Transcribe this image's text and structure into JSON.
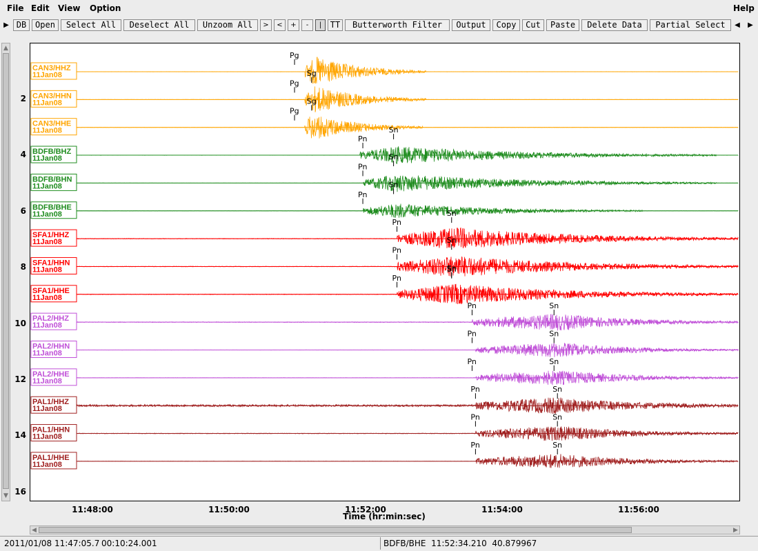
{
  "menus": {
    "file": "File",
    "edit": "Edit",
    "view": "View",
    "option": "Option",
    "help": "Help"
  },
  "toolbar": {
    "db": "DB",
    "open": "Open",
    "select_all": "Select All",
    "deselect_all": "Deselect All",
    "unzoom_all": "Unzoom All",
    "next": ">",
    "prev": "<",
    "plus": "+",
    "minus": "-",
    "cursor": "|",
    "tt": "TT",
    "butterworth": "Butterworth Filter",
    "output": "Output",
    "copy": "Copy",
    "cut": "Cut",
    "paste": "Paste",
    "delete_data": "Delete Data",
    "partial_select": "Partial Select"
  },
  "row_numbers": [
    "2",
    "4",
    "6",
    "8",
    "10",
    "12",
    "14",
    "16"
  ],
  "time_axis": {
    "ticks": [
      "11:48:00",
      "11:50:00",
      "11:52:00",
      "11:54:00",
      "11:56:00"
    ],
    "title": "Time (hr:min:sec)"
  },
  "colors": {
    "CAN3": "#ffa500",
    "BDFB": "#1e8c1e",
    "SFA1": "#ff0000",
    "PAL2": "#c050d8",
    "PAL1": "#a02020"
  },
  "traces": [
    {
      "station": "CAN3/HHZ",
      "date": "11Jan08",
      "color": "#ffa500",
      "onset": 4.1,
      "peak": 4.25,
      "amp": 2.2,
      "noise": 0.05,
      "dur": 0.9,
      "picks": [
        {
          "phase": "Pg",
          "t": 3.95,
          "yoff": -22
        },
        {
          "phase": "Sg",
          "t": 4.2,
          "yoff": 4
        }
      ]
    },
    {
      "station": "CAN3/HHN",
      "date": "11Jan08",
      "color": "#ffa500",
      "onset": 4.1,
      "peak": 4.25,
      "amp": 2.0,
      "noise": 0.05,
      "dur": 0.9,
      "picks": [
        {
          "phase": "Pg",
          "t": 3.95,
          "yoff": -22
        },
        {
          "phase": "Sg",
          "t": 4.2,
          "yoff": 4
        }
      ]
    },
    {
      "station": "CAN3/HHE",
      "date": "11Jan08",
      "color": "#ffa500",
      "onset": 4.1,
      "peak": 4.2,
      "amp": 1.9,
      "noise": 0.05,
      "dur": 0.9,
      "picks": [
        {
          "phase": "Pg",
          "t": 3.95,
          "yoff": -22
        }
      ]
    },
    {
      "station": "BDFB/BHZ",
      "date": "11Jan08",
      "color": "#1e8c1e",
      "onset": 4.9,
      "peak": 5.45,
      "amp": 1.3,
      "noise": 0.03,
      "dur": 2.6,
      "picks": [
        {
          "phase": "Pn",
          "t": 4.95,
          "yoff": -22
        },
        {
          "phase": "Sn",
          "t": 5.4,
          "yoff": -35
        },
        {
          "phase": "Sn",
          "t": 5.4,
          "yoff": 4
        }
      ]
    },
    {
      "station": "BDFB/BHN",
      "date": "11Jan08",
      "color": "#1e8c1e",
      "onset": 4.95,
      "peak": 5.45,
      "amp": 1.3,
      "noise": 0.03,
      "dur": 2.6,
      "picks": [
        {
          "phase": "Pn",
          "t": 4.95,
          "yoff": -22
        },
        {
          "phase": "Sn",
          "t": 5.4,
          "yoff": 4
        }
      ]
    },
    {
      "station": "BDFB/BHE",
      "date": "11Jan08",
      "color": "#1e8c1e",
      "onset": 4.95,
      "peak": 5.45,
      "amp": 1.1,
      "noise": 0.03,
      "dur": 2.0,
      "picks": [
        {
          "phase": "Pn",
          "t": 4.95,
          "yoff": -22
        }
      ]
    },
    {
      "station": "SFA1/HHZ",
      "date": "11Jan08",
      "color": "#ff0000",
      "onset": 5.45,
      "peak": 6.3,
      "amp": 1.6,
      "noise": 0.1,
      "dur": 3.0,
      "picks": [
        {
          "phase": "Pn",
          "t": 5.45,
          "yoff": -22
        },
        {
          "phase": "Sn",
          "t": 6.25,
          "yoff": -35
        },
        {
          "phase": "Sn",
          "t": 6.25,
          "yoff": 4
        }
      ]
    },
    {
      "station": "SFA1/HHN",
      "date": "11Jan08",
      "color": "#ff0000",
      "onset": 5.45,
      "peak": 6.3,
      "amp": 1.6,
      "noise": 0.1,
      "dur": 3.0,
      "picks": [
        {
          "phase": "Pn",
          "t": 5.45,
          "yoff": -22
        },
        {
          "phase": "Sn",
          "t": 6.25,
          "yoff": 4
        }
      ]
    },
    {
      "station": "SFA1/HHE",
      "date": "11Jan08",
      "color": "#ff0000",
      "onset": 5.45,
      "peak": 6.3,
      "amp": 1.5,
      "noise": 0.1,
      "dur": 2.8,
      "picks": [
        {
          "phase": "Pn",
          "t": 5.45,
          "yoff": -22
        },
        {
          "phase": "Sn",
          "t": 6.25,
          "yoff": -35
        }
      ]
    },
    {
      "station": "PAL2/HHZ",
      "date": "11Jan08",
      "color": "#c050d8",
      "onset": 6.55,
      "peak": 7.8,
      "amp": 1.2,
      "noise": 0.12,
      "dur": 3.0,
      "picks": [
        {
          "phase": "Pn",
          "t": 6.55,
          "yoff": -22
        },
        {
          "phase": "Sn",
          "t": 7.75,
          "yoff": -22
        }
      ]
    },
    {
      "station": "PAL2/HHN",
      "date": "11Jan08",
      "color": "#c050d8",
      "onset": 6.6,
      "peak": 7.8,
      "amp": 1.1,
      "noise": 0.05,
      "dur": 2.0,
      "picks": [
        {
          "phase": "Pn",
          "t": 6.55,
          "yoff": -22
        },
        {
          "phase": "Sn",
          "t": 7.75,
          "yoff": -22
        }
      ]
    },
    {
      "station": "PAL2/HHE",
      "date": "11Jan08",
      "color": "#c050d8",
      "onset": 6.6,
      "peak": 7.8,
      "amp": 1.1,
      "noise": 0.05,
      "dur": 2.0,
      "picks": [
        {
          "phase": "Pn",
          "t": 6.55,
          "yoff": -22
        },
        {
          "phase": "Sn",
          "t": 7.75,
          "yoff": -22
        }
      ]
    },
    {
      "station": "PAL1/HHZ",
      "date": "11Jan08",
      "color": "#a02020",
      "onset": 6.6,
      "peak": 7.8,
      "amp": 1.1,
      "noise": 0.35,
      "dur": 3.5,
      "picks": [
        {
          "phase": "Pn",
          "t": 6.6,
          "yoff": -22
        },
        {
          "phase": "Sn",
          "t": 7.8,
          "yoff": -22
        }
      ]
    },
    {
      "station": "PAL1/HHN",
      "date": "11Jan08",
      "color": "#a02020",
      "onset": 6.6,
      "peak": 7.8,
      "amp": 1.1,
      "noise": 0.12,
      "dur": 2.5,
      "picks": [
        {
          "phase": "Pn",
          "t": 6.6,
          "yoff": -22
        },
        {
          "phase": "Sn",
          "t": 7.8,
          "yoff": -22
        }
      ]
    },
    {
      "station": "PAL1/HHE",
      "date": "11Jan08",
      "color": "#a02020",
      "onset": 6.6,
      "peak": 7.8,
      "amp": 1.1,
      "noise": 0.05,
      "dur": 2.3,
      "picks": [
        {
          "phase": "Pn",
          "t": 6.6,
          "yoff": -22
        },
        {
          "phase": "Sn",
          "t": 7.8,
          "yoff": -22
        }
      ]
    }
  ],
  "status": {
    "time": "2011/01/08 11:47:05.7",
    "duration": "00:10:24.001",
    "cursor": "BDFB/BHE  11:52:34.210  40.879967"
  }
}
